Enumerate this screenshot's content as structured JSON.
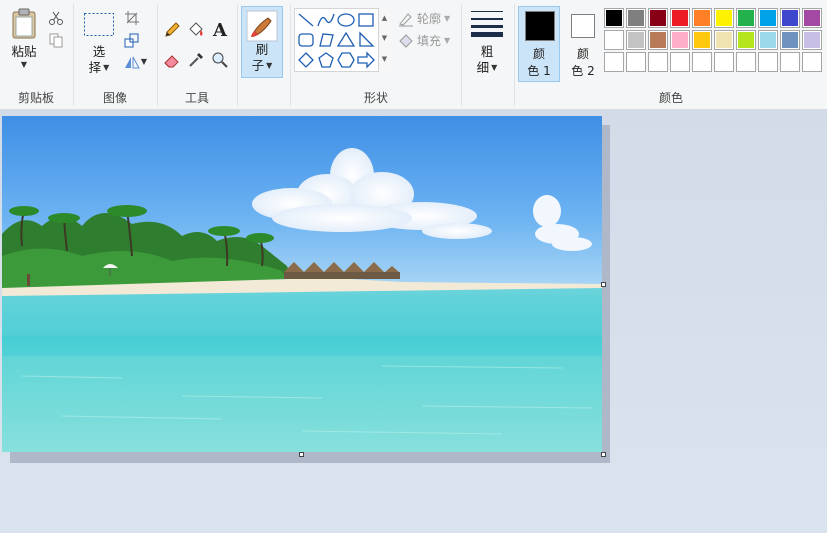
{
  "clipboard": {
    "paste_label": "粘贴",
    "group_label": "剪贴板"
  },
  "image": {
    "select_label_1": "选",
    "select_label_2": "择",
    "group_label": "图像"
  },
  "tools": {
    "group_label": "工具"
  },
  "brushes": {
    "label_1": "刷",
    "label_2": "子"
  },
  "shapes": {
    "outline_label": "轮廓",
    "fill_label": "填充",
    "group_label": "形状"
  },
  "size": {
    "label_1": "粗",
    "label_2": "细"
  },
  "colors": {
    "color1_label_1": "颜",
    "color1_label_2": "色 1",
    "color2_label_1": "颜",
    "color2_label_2": "色 2",
    "color1_value": "#000000",
    "color2_value": "#ffffff",
    "group_label": "颜色",
    "palette_row1": [
      "#000000",
      "#7f7f7f",
      "#880015",
      "#ed1c24",
      "#ff7f27",
      "#fff200",
      "#22b14c",
      "#00a2e8",
      "#3f48cc",
      "#a349a4"
    ],
    "palette_row2": [
      "#ffffff",
      "#c3c3c3",
      "#b97a57",
      "#ffaec9",
      "#ffc90e",
      "#efe4b0",
      "#b5e61d",
      "#99d9ea",
      "#7092be",
      "#c8bfe7"
    ],
    "palette_row3": [
      "#ffffff",
      "#ffffff",
      "#ffffff",
      "#ffffff",
      "#ffffff",
      "#ffffff",
      "#ffffff",
      "#ffffff",
      "#ffffff",
      "#ffffff"
    ]
  }
}
